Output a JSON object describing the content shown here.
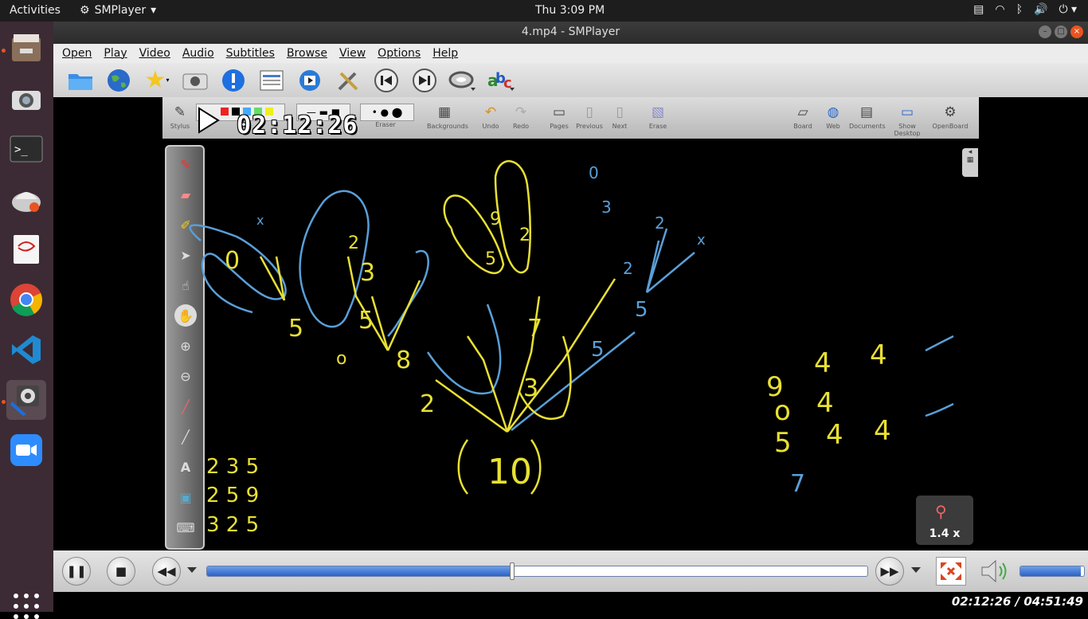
{
  "topbar": {
    "activities": "Activities",
    "app_name": "SMPlayer",
    "clock": "Thu  3:09 PM"
  },
  "window": {
    "title": "4.mp4 - SMPlayer"
  },
  "menu": [
    "Open",
    "Play",
    "Video",
    "Audio",
    "Subtitles",
    "Browse",
    "View",
    "Options",
    "Help"
  ],
  "toolbar_icons": [
    "folder-icon",
    "globe-icon",
    "favorites-star-icon",
    "screenshot-camera-icon",
    "info-icon",
    "playlist-icon",
    "media-info-icon",
    "preferences-tools-icon",
    "previous-icon",
    "next-icon",
    "audio-track-icon",
    "subtitles-abc-icon"
  ],
  "video": {
    "osd_time": "02:12:26",
    "zoom_label": "1.4 x",
    "openboard_tools": [
      {
        "label": "Stylus",
        "icon": "stylus-icon"
      },
      {
        "label": "Eraser",
        "icon": "eraser-icon"
      },
      {
        "label": "Backgrounds",
        "icon": "backgrounds-icon"
      },
      {
        "label": "Undo",
        "icon": "undo-icon"
      },
      {
        "label": "Redo",
        "icon": "redo-icon"
      },
      {
        "label": "Pages",
        "icon": "pages-icon"
      },
      {
        "label": "Previous",
        "icon": "previous-page-icon"
      },
      {
        "label": "Next",
        "icon": "next-page-icon"
      },
      {
        "label": "Erase",
        "icon": "erase-icon"
      },
      {
        "label": "Board",
        "icon": "board-icon"
      },
      {
        "label": "Web",
        "icon": "web-icon"
      },
      {
        "label": "Documents",
        "icon": "documents-icon"
      },
      {
        "label": "Show Desktop",
        "icon": "show-desktop-icon"
      },
      {
        "label": "OpenBoard",
        "icon": "openboard-icon"
      }
    ],
    "whiteboard_numbers": [
      "5",
      "5",
      "3",
      "3",
      "5",
      "8",
      "7",
      "7",
      "3",
      "2",
      "5",
      "5",
      "2",
      "3",
      "10",
      "9",
      "4",
      "4",
      "9",
      "4",
      "5",
      "4",
      "4",
      "7",
      "2",
      "3",
      "5",
      "2",
      "5",
      "9",
      "3",
      "2",
      "5",
      "0",
      "x",
      "0",
      "x"
    ]
  },
  "controls": {
    "progress": 0.4624,
    "volume": 0.95
  },
  "status": {
    "time": "02:12:26 / 04:51:49"
  },
  "colors": {
    "dock_bg": "#3c2b34",
    "accent": "#e95420",
    "seek_blue": "#2f63c4",
    "chalk_yellow": "#e8e033",
    "chalk_blue": "#5a9fd8"
  }
}
